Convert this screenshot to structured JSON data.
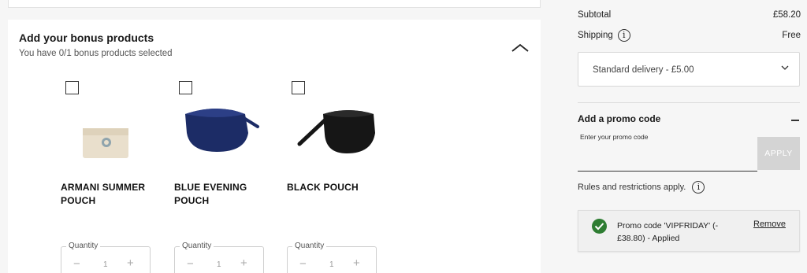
{
  "bonus": {
    "title": "Add your bonus products",
    "subtitle": "You have 0/1 bonus products selected",
    "collapse_icon": "chevron-up-icon",
    "products": [
      {
        "name": "ARMANI SUMMER POUCH",
        "quantity_label": "Quantity",
        "quantity": "1",
        "image": "beige-pouch-image",
        "checked": false
      },
      {
        "name": "BLUE EVENING POUCH",
        "quantity_label": "Quantity",
        "quantity": "1",
        "image": "blue-pouch-image",
        "checked": false
      },
      {
        "name": "BLACK POUCH",
        "quantity_label": "Quantity",
        "quantity": "1",
        "image": "black-pouch-image",
        "checked": false
      }
    ]
  },
  "summary": {
    "subtotal_label": "Subtotal",
    "subtotal_value": "£58.20",
    "shipping_label": "Shipping",
    "shipping_value": "Free",
    "delivery_option": "Standard delivery - £5.00",
    "promo_title": "Add a promo code",
    "promo_input_label": "Enter your promo code",
    "promo_input_value": "",
    "apply_label": "APPLY",
    "rules_text": "Rules and restrictions apply.",
    "applied_text": "Promo code 'VIPFRIDAY' (-£38.80) - Applied",
    "remove_label": "Remove"
  },
  "colors": {
    "success": "#2e7d32",
    "apply_disabled": "#d4d4d4"
  }
}
